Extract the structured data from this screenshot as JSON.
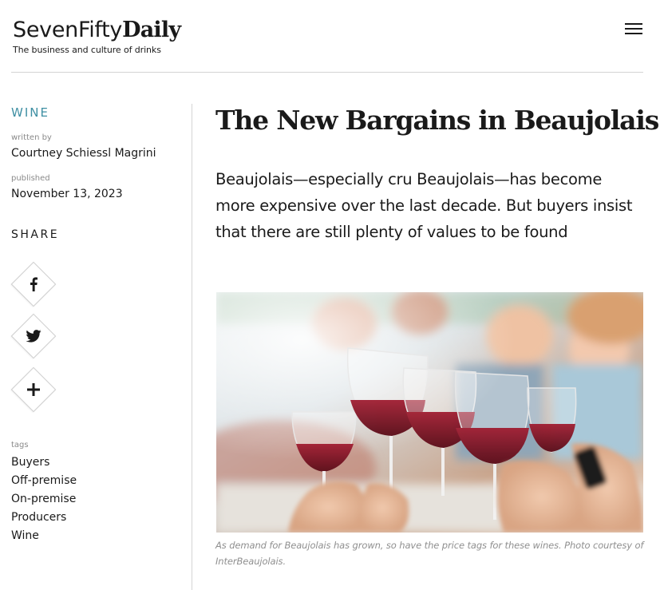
{
  "header": {
    "logo": {
      "light": "SevenFifty",
      "bold": "Daily",
      "tagline": "The business and culture of drinks"
    },
    "menu_icon": "hamburger-menu-icon"
  },
  "sidebar": {
    "category": "WINE",
    "author_label": "written by",
    "author": "Courtney Schiessl Magrini",
    "published_label": "published",
    "published": "November 13, 2023",
    "share_heading": "SHARE",
    "share_buttons": [
      {
        "icon": "facebook-icon"
      },
      {
        "icon": "twitter-icon"
      },
      {
        "icon": "plus-icon"
      }
    ],
    "tags_label": "tags",
    "tags": [
      "Buyers",
      "Off-premise",
      "On-premise",
      "Producers",
      "Wine"
    ]
  },
  "article": {
    "title": "The New Bargains in Beaujolais",
    "dek": "Beaujolais—especially cru Beaujolais—has become more expensive over the last decade. But buyers insist that there are still plenty of values to be found",
    "image_caption": "As demand for Beaujolais has grown, so have the price tags for these wines. Photo courtesy of InterBeaujolais."
  },
  "colors": {
    "accent": "#3e8fa3",
    "text": "#1a1a1a",
    "muted": "#8a8a8a",
    "rule": "#d4d4d4",
    "wine": "#7a1424"
  }
}
